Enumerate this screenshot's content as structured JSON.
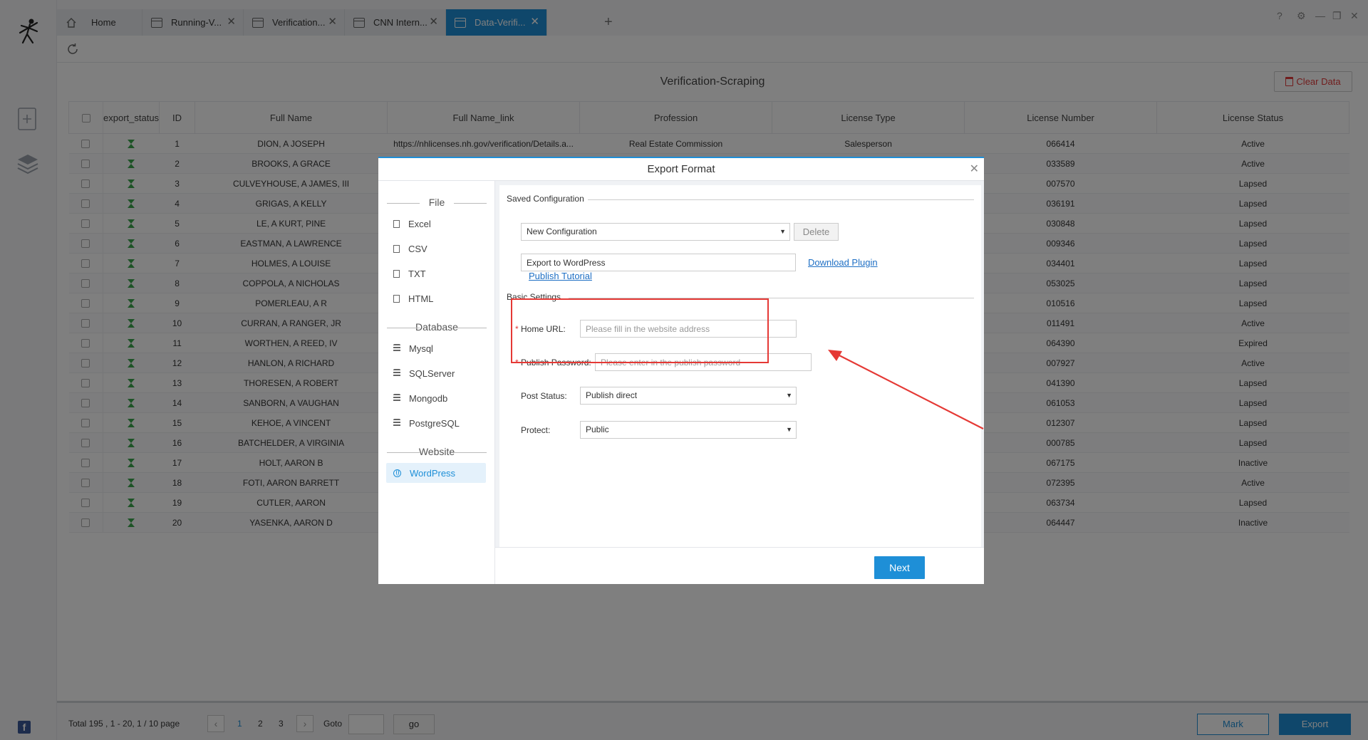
{
  "tabs": [
    {
      "label": "Home",
      "icon": "home-icon",
      "closable": false
    },
    {
      "label": "Running-V...",
      "icon": "window-icon",
      "closable": true
    },
    {
      "label": "Verification...",
      "icon": "window-icon",
      "closable": true
    },
    {
      "label": "CNN Intern...",
      "icon": "window-icon",
      "closable": true
    },
    {
      "label": "Data-Verifi...",
      "icon": "window-icon",
      "closable": true,
      "active": true
    }
  ],
  "page": {
    "title": "Verification-Scraping",
    "clear_label": "Clear Data"
  },
  "table": {
    "columns": [
      "export_status",
      "ID",
      "Full Name",
      "Full Name_link",
      "Profession",
      "License Type",
      "License Number",
      "License Status"
    ],
    "rows": [
      [
        "1",
        "DION, A JOSEPH",
        "https://nhlicenses.nh.gov/verification/Details.a...",
        "Real Estate Commission",
        "Salesperson",
        "066414",
        "Active"
      ],
      [
        "2",
        "BROOKS, A GRACE",
        "",
        "",
        "",
        "033589",
        "Active"
      ],
      [
        "3",
        "CULVEYHOUSE, A JAMES, III",
        "",
        "",
        "",
        "007570",
        "Lapsed"
      ],
      [
        "4",
        "GRIGAS, A KELLY",
        "",
        "",
        "",
        "036191",
        "Lapsed"
      ],
      [
        "5",
        "LE, A KURT, PINE",
        "",
        "",
        "",
        "030848",
        "Lapsed"
      ],
      [
        "6",
        "EASTMAN, A LAWRENCE",
        "",
        "",
        "",
        "009346",
        "Lapsed"
      ],
      [
        "7",
        "HOLMES, A LOUISE",
        "",
        "",
        "",
        "034401",
        "Lapsed"
      ],
      [
        "8",
        "COPPOLA, A NICHOLAS",
        "",
        "",
        "",
        "053025",
        "Lapsed"
      ],
      [
        "9",
        "POMERLEAU, A R",
        "",
        "",
        "",
        "010516",
        "Lapsed"
      ],
      [
        "10",
        "CURRAN, A RANGER, JR",
        "",
        "",
        "",
        "011491",
        "Active"
      ],
      [
        "11",
        "WORTHEN, A REED, IV",
        "",
        "",
        "",
        "064390",
        "Expired"
      ],
      [
        "12",
        "HANLON, A RICHARD",
        "",
        "",
        "",
        "007927",
        "Active"
      ],
      [
        "13",
        "THORESEN, A ROBERT",
        "",
        "",
        "",
        "041390",
        "Lapsed"
      ],
      [
        "14",
        "SANBORN, A VAUGHAN",
        "",
        "",
        "",
        "061053",
        "Lapsed"
      ],
      [
        "15",
        "KEHOE, A VINCENT",
        "",
        "",
        "",
        "012307",
        "Lapsed"
      ],
      [
        "16",
        "BATCHELDER, A VIRGINIA",
        "",
        "",
        "",
        "000785",
        "Lapsed"
      ],
      [
        "17",
        "HOLT, AARON B",
        "",
        "",
        "",
        "067175",
        "Inactive"
      ],
      [
        "18",
        "FOTI, AARON BARRETT",
        "",
        "",
        "",
        "072395",
        "Active"
      ],
      [
        "19",
        "CUTLER, AARON",
        "",
        "",
        "",
        "063734",
        "Lapsed"
      ],
      [
        "20",
        "YASENKA, AARON D",
        "",
        "",
        "",
        "064447",
        "Inactive"
      ]
    ]
  },
  "footer": {
    "total_text": "Total  195 ,  1  - 20,  1  / 10 page",
    "pages": [
      "1",
      "2",
      "3"
    ],
    "current_page": "1",
    "goto_label": "Goto",
    "go_label": "go",
    "mark_label": "Mark",
    "export_label": "Export"
  },
  "modal": {
    "title": "Export Format",
    "sections": [
      {
        "title": "File",
        "items": [
          "Excel",
          "CSV",
          "TXT",
          "HTML"
        ]
      },
      {
        "title": "Database",
        "items": [
          "Mysql",
          "SQLServer",
          "Mongodb",
          "PostgreSQL"
        ]
      },
      {
        "title": "Website",
        "items": [
          "WordPress"
        ]
      }
    ],
    "selected_item": "WordPress",
    "saved_config_title": "Saved Configuration",
    "config_select_value": "New Configuration",
    "delete_label": "Delete",
    "config_name_value": "Export to WordPress",
    "download_plugin_label": "Download Plugin",
    "publish_tutorial_label": "Publish Tutorial",
    "basic_settings_title": "Basic Settings",
    "home_url_label": "Home URL:",
    "home_url_placeholder": "Please fill in the website address",
    "publish_password_label": "Publish Password:",
    "publish_password_placeholder": "Please enter in the publish password",
    "post_status_label": "Post Status:",
    "post_status_value": "Publish direct",
    "protect_label": "Protect:",
    "protect_value": "Public",
    "next_label": "Next"
  },
  "colors": {
    "accent": "#1e8fd7",
    "highlight": "#e53935",
    "status_icon": "#3aa64d"
  }
}
